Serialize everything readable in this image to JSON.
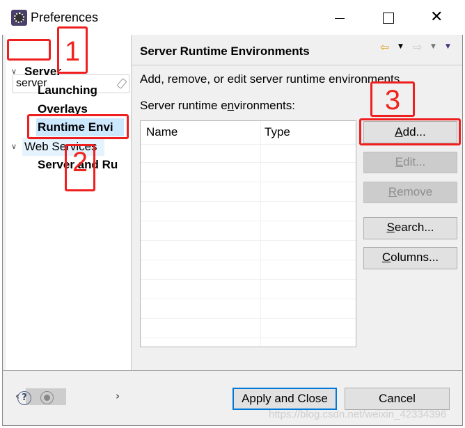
{
  "window": {
    "title": "Preferences",
    "minimize": "minimize",
    "maximize": "maximize",
    "close": "✕"
  },
  "sidebar": {
    "search": {
      "value": "server"
    },
    "tree": [
      {
        "label": "Server",
        "expanded": true
      },
      {
        "label": "Launching"
      },
      {
        "label": "Overlays"
      },
      {
        "label": "Runtime Envi",
        "selected": true
      },
      {
        "label": "Web Services",
        "expanded": true
      },
      {
        "label": "Server and Ru"
      }
    ]
  },
  "page": {
    "title": "Server Runtime Environments",
    "description": "Add, remove, or edit server runtime environments.",
    "list_label": {
      "pre": "Server runtime e",
      "u": "n",
      "post": "vironments:"
    },
    "table": {
      "columns": [
        "Name",
        "Type"
      ],
      "rows": []
    },
    "buttons": {
      "add": {
        "pre": "",
        "u": "A",
        "post": "dd...",
        "enabled": true
      },
      "edit": {
        "pre": "",
        "u": "E",
        "post": "dit...",
        "enabled": false
      },
      "remove": {
        "pre": "",
        "u": "R",
        "post": "emove",
        "enabled": false
      },
      "search": {
        "pre": "",
        "u": "S",
        "post": "earch...",
        "enabled": true
      },
      "columns": {
        "pre": "",
        "u": "C",
        "post": "olumns...",
        "enabled": true
      }
    }
  },
  "footer": {
    "help": "?",
    "apply": "Apply and Close",
    "cancel": "Cancel"
  },
  "annotations": [
    "1",
    "2",
    "3"
  ],
  "watermark": "https://blog.csdn.net/weixin_42334396",
  "colors": {
    "annotation": "#f01f1f",
    "selection": "#cce8ff",
    "default_button_border": "#0078d7"
  }
}
